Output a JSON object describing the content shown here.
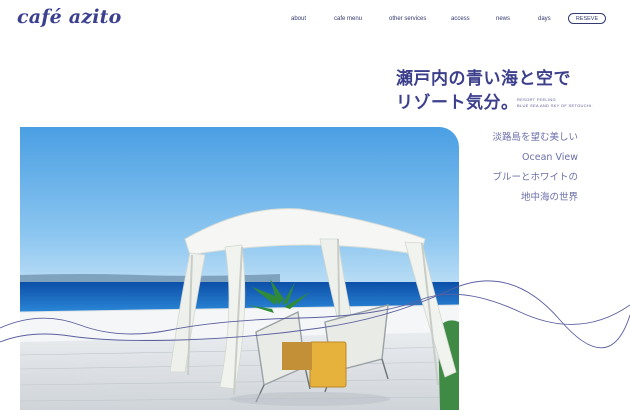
{
  "logo": "café azito",
  "nav": {
    "items": [
      "about",
      "cafe menu",
      "other services",
      "access",
      "news",
      "days"
    ],
    "reserve": "RESEVE"
  },
  "headline": {
    "line1": "瀬戸内の青い海と空で",
    "line2": "リゾート気分。",
    "sub_en_1": "RESORT FEELING",
    "sub_en_2": "BLUE SEA AND SKY OF SETOUCHI."
  },
  "copy": {
    "line1": "淡路島を望む美しい",
    "line2": "Ocean View",
    "line3": "ブルーとホワイトの",
    "line4": "地中海の世界"
  },
  "colors": {
    "brand": "#3b3f8f",
    "sky": "#5aa9e6",
    "sea": "#1a6fc4"
  }
}
